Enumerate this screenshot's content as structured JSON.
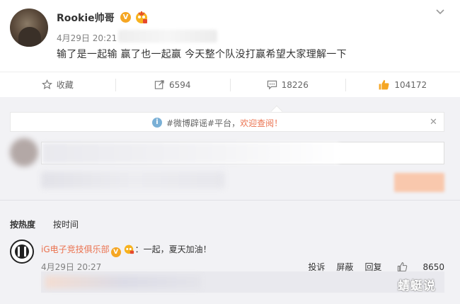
{
  "post": {
    "author": "Rookie帅哥",
    "verified_badge": "V",
    "timestamp": "4月29日 20:21",
    "text": "输了是一起输 赢了也一起赢 今天整个队没打赢希望大家理解一下",
    "menu_icon": "chevron-down-icon"
  },
  "actions": {
    "favorite": {
      "label": "收藏",
      "icon": "star-icon"
    },
    "repost": {
      "count": "6594",
      "icon": "repost-icon"
    },
    "comment": {
      "count": "18226",
      "icon": "comment-icon"
    },
    "like": {
      "count": "104172",
      "icon": "thumbs-up-icon"
    }
  },
  "notice": {
    "info_glyph": "i",
    "prefix": "#微博辟谣#平台，",
    "link": "欢迎查阅！",
    "close": "✕"
  },
  "sort": {
    "hot": "按热度",
    "time": "按时间"
  },
  "comment": {
    "author": "iG电子竞技俱乐部",
    "verified_badge": "V",
    "text": "：一起，夏天加油！",
    "timestamp": "4月29日 20:27",
    "report": "投诉",
    "block": "屏蔽",
    "reply": "回复",
    "likes": "8650"
  },
  "watermark": "蜻蜓说",
  "colors": {
    "accent": "#eb7350",
    "badge": "#f5a623",
    "like_orange": "#f5a623",
    "background": "#f2f2f5"
  }
}
